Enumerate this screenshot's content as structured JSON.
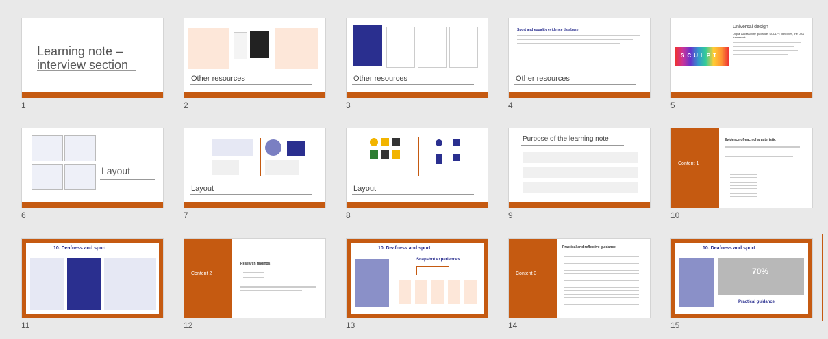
{
  "slides": [
    {
      "number": "1",
      "title_line1": "Learning note –",
      "title_line2": "interview section"
    },
    {
      "number": "2",
      "title": "Other resources"
    },
    {
      "number": "3",
      "title": "Other resources"
    },
    {
      "number": "4",
      "title": "Other resources",
      "heading": "Sport and equality evidence database"
    },
    {
      "number": "5",
      "title": "Universal design",
      "subtitle": "Digital Accessibility guidance, SCULPT principles, the DAST framework",
      "sculpt": "SCULPT"
    },
    {
      "number": "6",
      "title": "Layout"
    },
    {
      "number": "7",
      "title": "Layout"
    },
    {
      "number": "8",
      "title": "Layout"
    },
    {
      "number": "9",
      "title": "Purpose of the learning note"
    },
    {
      "number": "10",
      "side_label": "Content 1",
      "heading": "Evidence of each characteristic"
    },
    {
      "number": "11",
      "heading": "10. Deafness and sport"
    },
    {
      "number": "12",
      "side_label": "Content 2",
      "heading": "Research findings"
    },
    {
      "number": "13",
      "heading": "10. Deafness and sport",
      "sub": "Snapshot experiences"
    },
    {
      "number": "14",
      "side_label": "Content 3",
      "heading": "Practical and reflective guidance"
    },
    {
      "number": "15",
      "heading": "10. Deafness and sport",
      "sub": "Practical guidance",
      "stat": "70%"
    }
  ],
  "colors": {
    "accent": "#c55a11",
    "navy": "#2a2f8f",
    "background": "#e9e9e9"
  }
}
